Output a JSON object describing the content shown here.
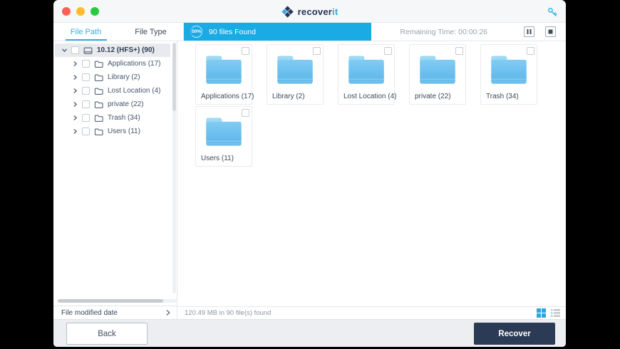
{
  "titlebar": {
    "logo": {
      "primary": "recover",
      "accent": "it"
    }
  },
  "tabs": [
    {
      "label": "File Path",
      "active": true
    },
    {
      "label": "File Type",
      "active": false
    }
  ],
  "progress": {
    "percent": "50%",
    "message": "90 files Found",
    "remaining": "Remaining Time: 00:00:26"
  },
  "sidebar": {
    "root": {
      "label": "10.12 (HFS+) (90)"
    },
    "children": [
      {
        "label": "Applications (17)"
      },
      {
        "label": "Library (2)"
      },
      {
        "label": "Lost Location (4)"
      },
      {
        "label": "private (22)"
      },
      {
        "label": "Trash (34)"
      },
      {
        "label": "Users (11)"
      }
    ],
    "footer_label": "File modified date"
  },
  "main": {
    "folders": [
      {
        "label": "Applications (17)"
      },
      {
        "label": "Library (2)"
      },
      {
        "label": "Lost Location (4)"
      },
      {
        "label": "private (22)"
      },
      {
        "label": "Trash (34)"
      },
      {
        "label": "Users (11)"
      }
    ],
    "status": "120.49 MB in 90 file(s) found"
  },
  "actions": {
    "back": "Back",
    "recover": "Recover"
  },
  "colors": {
    "accent": "#1babe4",
    "navy": "#2c3b55",
    "folder_blue": "#66bdec"
  }
}
